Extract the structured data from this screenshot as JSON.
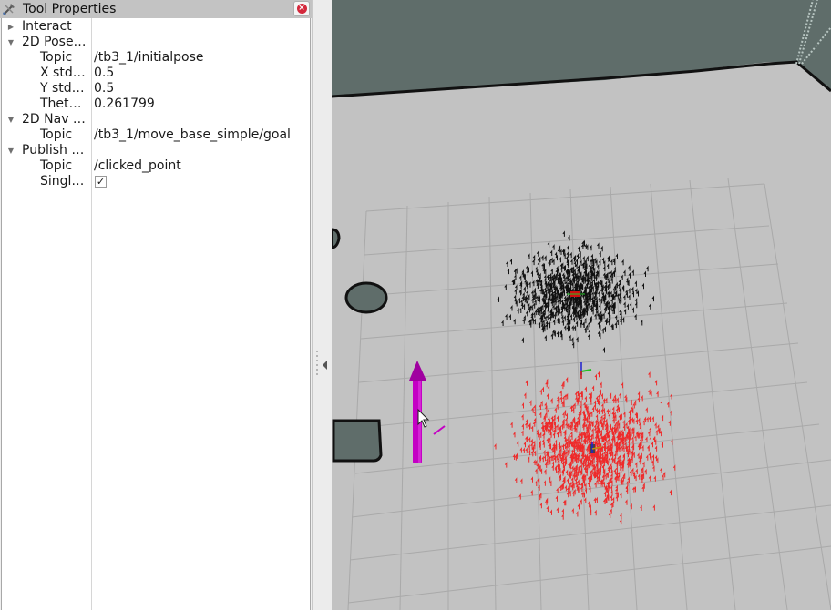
{
  "panel": {
    "title": "Tool Properties",
    "title_icon": "tools-icon",
    "close_icon": "close-icon",
    "rows": [
      {
        "kind": "group",
        "label": "Interact",
        "expanded": false
      },
      {
        "kind": "group",
        "label": "2D Pose…",
        "expanded": true
      },
      {
        "kind": "prop",
        "label": "Topic",
        "value": "/tb3_1/initialpose"
      },
      {
        "kind": "prop",
        "label": "X std…",
        "value": "0.5"
      },
      {
        "kind": "prop",
        "label": "Y std…",
        "value": "0.5"
      },
      {
        "kind": "prop",
        "label": "Thet…",
        "value": "0.261799"
      },
      {
        "kind": "group",
        "label": "2D Nav …",
        "expanded": true
      },
      {
        "kind": "prop",
        "label": "Topic",
        "value": "/tb3_1/move_base_simple/goal"
      },
      {
        "kind": "group",
        "label": "Publish …",
        "expanded": true
      },
      {
        "kind": "prop",
        "label": "Topic",
        "value": "/clicked_point"
      },
      {
        "kind": "check",
        "label": "Singl…",
        "checked": true,
        "glyph": "✓"
      }
    ]
  },
  "splitter": {
    "collapse_icon": "collapse-left-icon"
  },
  "viewport": {
    "colors": {
      "floor": "#c2c2c2",
      "wall": "#5f6d6a",
      "grid": "#a9a9a9",
      "obstacle_fill": "#5f6d6a",
      "obstacle_edge": "#111111",
      "particles_robot1": "#111111",
      "particles_robot2": "#ee2a2a",
      "pose_arrow": "#c400c4"
    },
    "objects": [
      "occupancy-map",
      "grid",
      "robot1-particle-cloud",
      "robot2-particle-cloud",
      "pose-estimate-arrow",
      "mouse-cursor"
    ]
  }
}
